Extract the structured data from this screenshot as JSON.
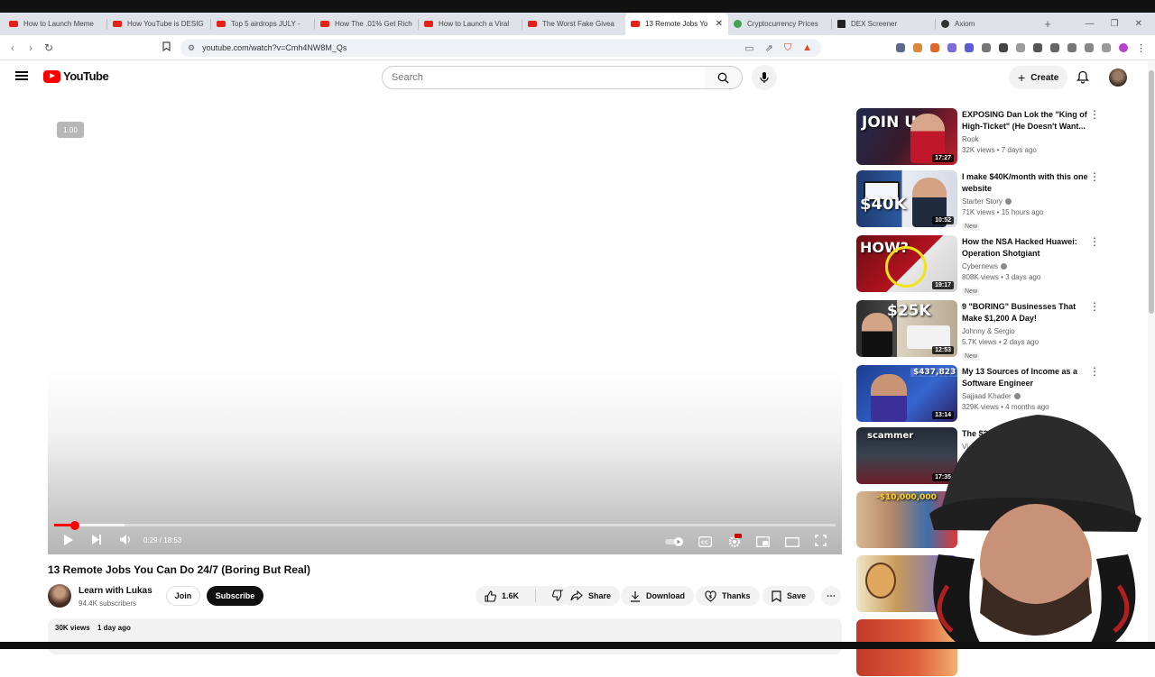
{
  "browser": {
    "tabs": [
      {
        "title": "How to Launch Meme",
        "icon": "youtube-favicon"
      },
      {
        "title": "How YouTube is DESIG",
        "icon": "youtube-favicon"
      },
      {
        "title": "Top 5 airdrops JULY -",
        "icon": "youtube-favicon"
      },
      {
        "title": "How The .01% Get Rich",
        "icon": "youtube-favicon"
      },
      {
        "title": "How to Launch a Viral",
        "icon": "youtube-favicon"
      },
      {
        "title": "The Worst Fake Givea",
        "icon": "youtube-favicon"
      },
      {
        "title": "13 Remote Jobs Yo",
        "icon": "youtube-favicon",
        "active": true
      },
      {
        "title": "Cryptocurrency Prices",
        "icon": "coingecko-favicon"
      },
      {
        "title": "DEX Screener",
        "icon": "dexscreener-favicon"
      },
      {
        "title": "Axiom",
        "icon": "axiom-favicon"
      }
    ],
    "url": "youtube.com/watch?v=Cmh4NW8M_Qs"
  },
  "header": {
    "logo_text": "YouTube",
    "search_placeholder": "Search",
    "create_label": "Create"
  },
  "player": {
    "speed_badge": "1.00",
    "time_current": "0:29",
    "time_total": "18:53",
    "time_display": "0:29 / 18:53",
    "progress_fraction": 0.026,
    "buffer_fraction": 0.09
  },
  "video": {
    "title": "13 Remote Jobs You Can Do 24/7 (Boring But Real)",
    "channel_name": "Learn with Lukas",
    "channel_subs": "94.4K subscribers",
    "join_label": "Join",
    "subscribe_label": "Subscribe",
    "likes": "1.6K",
    "share_label": "Share",
    "download_label": "Download",
    "thanks_label": "Thanks",
    "save_label": "Save",
    "views": "30K views",
    "uploaded": "1 day ago"
  },
  "recommendations": [
    {
      "title": "EXPOSING Dan Lok the \"King of High-Ticket\" (He Doesn't Want...",
      "channel": "Rook",
      "verified": false,
      "stats": "32K views • 7 days ago",
      "duration": "17:27",
      "badge": "",
      "thumb_text": "JOIN US"
    },
    {
      "title": "I make $40K/month with this one website",
      "channel": "Starter Story",
      "verified": true,
      "stats": "71K views • 15 hours ago",
      "duration": "10:52",
      "badge": "New",
      "thumb_text": "$40K"
    },
    {
      "title": "How the NSA Hacked Huawei: Operation Shotgiant",
      "channel": "Cybernews",
      "verified": true,
      "stats": "808K views • 3 days ago",
      "duration": "19:17",
      "badge": "New",
      "thumb_text": "HOW?"
    },
    {
      "title": "9 \"BORING\" Businesses That Make $1,200 A Day!",
      "channel": "Johnny & Sergio",
      "verified": false,
      "stats": "5.7K views • 2 days ago",
      "duration": "12:53",
      "badge": "New",
      "thumb_text": "$25K"
    },
    {
      "title": "My 13 Sources of Income as a Software Engineer",
      "channel": "Sajjaad Khader",
      "verified": true,
      "stats": "329K views • 4 months ago",
      "duration": "13:14",
      "badge": "",
      "thumb_text": "$437,823"
    },
    {
      "title": "The $200,00",
      "channel": "Vi",
      "verified": false,
      "stats": "",
      "duration": "17:35",
      "badge": "",
      "thumb_text": "scammer"
    },
    {
      "title": "",
      "channel": "",
      "verified": false,
      "stats": "",
      "duration": "",
      "badge": "",
      "thumb_text": "-$10,000,000"
    },
    {
      "title": "",
      "channel": "",
      "verified": false,
      "stats": "",
      "duration": "",
      "badge": "",
      "thumb_text": ""
    },
    {
      "title": "",
      "channel": "",
      "verified": false,
      "stats": "",
      "duration": "",
      "badge": "",
      "thumb_text": ""
    }
  ],
  "colors": {
    "youtube_red": "#ff0000",
    "text_primary": "#0f0f0f",
    "text_secondary": "#606060",
    "pill_bg": "#f2f2f2"
  }
}
